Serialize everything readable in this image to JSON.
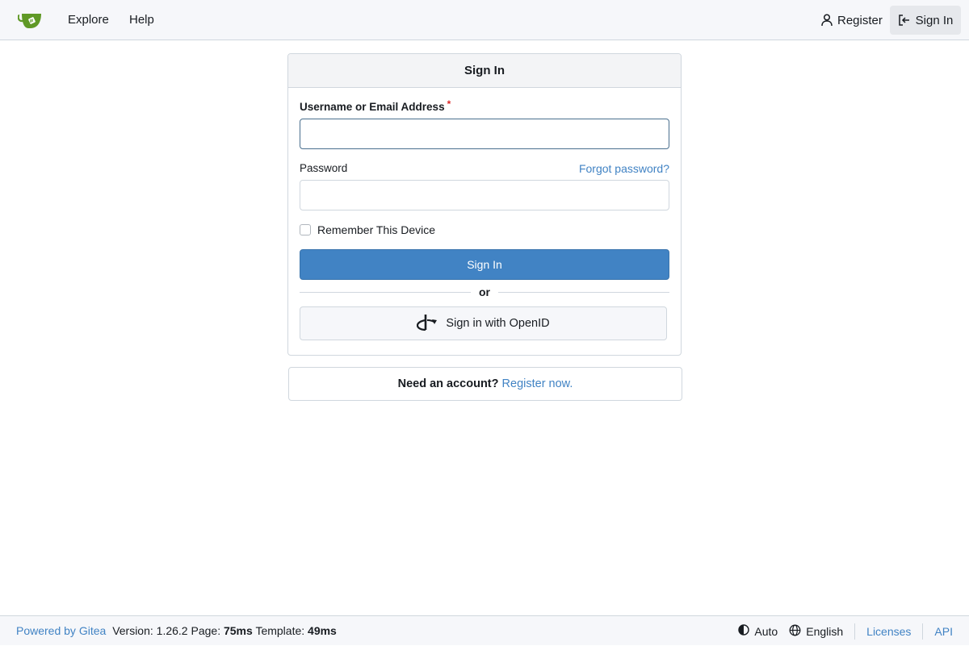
{
  "colors": {
    "accent": "#4183c4",
    "logo_green": "#609926",
    "required": "#db2828"
  },
  "nav": {
    "logo_icon": "gitea-teacup-logo",
    "explore": "Explore",
    "help": "Help",
    "register": "Register",
    "register_icon": "person-icon",
    "sign_in": "Sign In",
    "sign_in_icon": "sign-in-icon"
  },
  "signin_card": {
    "title": "Sign In",
    "username_label": "Username or Email Address",
    "required_mark": "*",
    "username_value": "",
    "password_label": "Password",
    "password_value": "",
    "forgot_password": "Forgot password?",
    "remember_device": "Remember This Device",
    "remember_checked": false,
    "submit": "Sign In",
    "divider": "or",
    "openid_button": "Sign in with OpenID",
    "openid_icon": "openid-icon"
  },
  "register_card": {
    "prompt": "Need an account?",
    "link": "Register now."
  },
  "footer": {
    "powered_by": "Powered by Gitea",
    "version_label": "Version:",
    "version": "1.26.2",
    "page_label": "Page:",
    "page_time": "75ms",
    "template_label": "Template:",
    "template_time": "49ms",
    "theme": "Auto",
    "theme_icon": "theme-half-circle-icon",
    "language": "English",
    "language_icon": "globe-icon",
    "licenses": "Licenses",
    "api": "API"
  }
}
